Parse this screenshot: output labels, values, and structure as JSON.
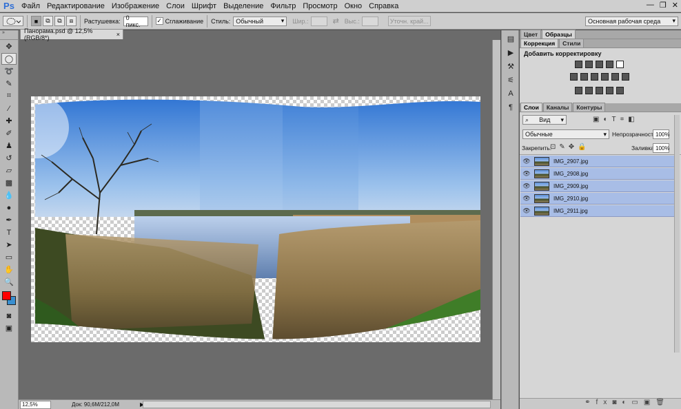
{
  "app": {
    "logo": "Ps"
  },
  "menu": [
    "Файл",
    "Редактирование",
    "Изображение",
    "Слои",
    "Шрифт",
    "Выделение",
    "Фильтр",
    "Просмотр",
    "Окно",
    "Справка"
  ],
  "window_controls": {
    "minimize": "—",
    "restore": "❐",
    "close": "✕"
  },
  "options": {
    "feather_label": "Растушевка:",
    "feather_value": "0 пикс.",
    "antialias_label": "Сглаживание",
    "style_label": "Стиль:",
    "style_value": "Обычный",
    "width_label": "Шир.:",
    "height_label": "Выс.:",
    "refine_edge": "Уточн. край...",
    "workspace": "Основная рабочая среда"
  },
  "document": {
    "tab_title": "Панорама.psd @ 12,5% (RGB/8*)",
    "close": "×",
    "zoom": "12,5%",
    "doc_info": "Док: 90,6M/212,0M"
  },
  "panels": {
    "top_tabs": [
      "Цвет",
      "Образцы"
    ],
    "adj_tabs": [
      "Коррекция",
      "Стили"
    ],
    "adj_title": "Добавить корректировку",
    "layers_tabs": [
      "Слои",
      "Каналы",
      "Контуры"
    ],
    "kind_value": "Вид",
    "blend_mode": "Обычные",
    "opacity_label": "Непрозрачность:",
    "opacity_value": "100%",
    "lock_label": "Закрепить:",
    "fill_label": "Заливка:",
    "fill_value": "100%",
    "layers": [
      "IMG_2907.jpg",
      "IMG_2908.jpg",
      "IMG_2909.jpg",
      "IMG_2910.jpg",
      "IMG_2911.jpg"
    ]
  },
  "colors": {
    "foreground": "#ff0000",
    "background": "#3a8fd0",
    "layer_selected": "#a8bde6",
    "accent": "#2f6fd6"
  }
}
